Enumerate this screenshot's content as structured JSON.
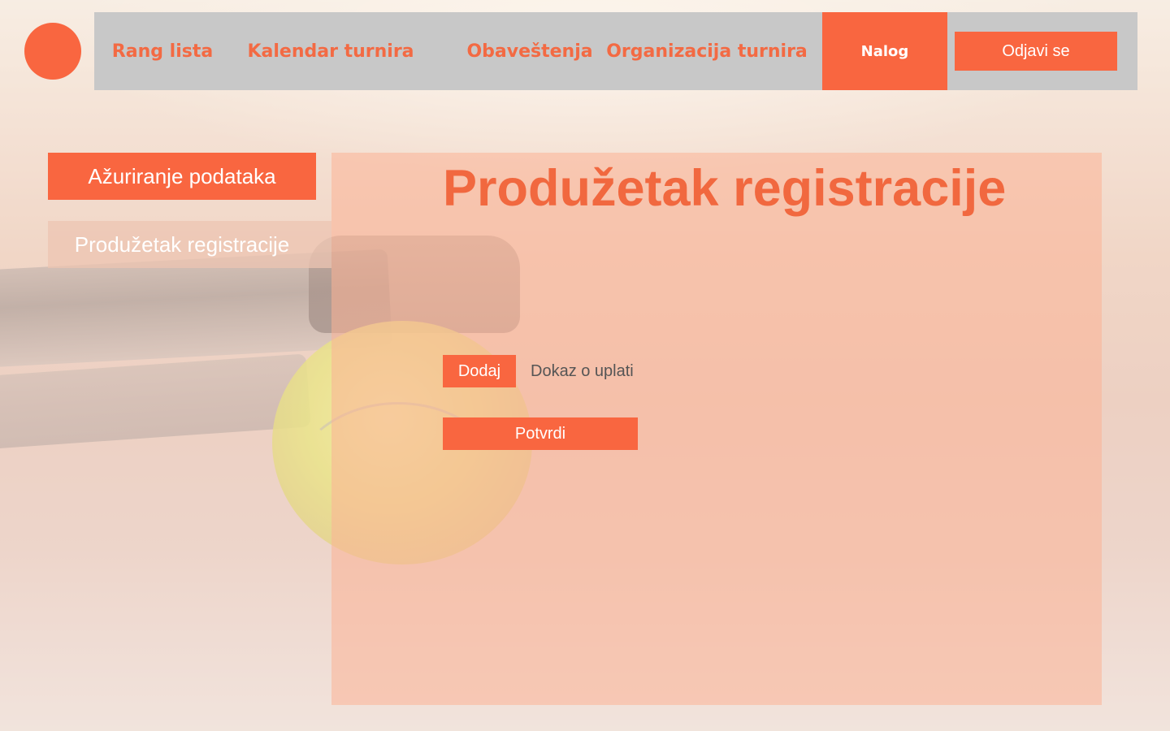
{
  "nav": {
    "items": [
      {
        "label": "Rang lista"
      },
      {
        "label": "Kalendar turnira"
      },
      {
        "label": "Obaveštenja"
      },
      {
        "label": "Organizacija turnira"
      },
      {
        "label": "Nalog",
        "active": true
      }
    ],
    "logout_label": "Odjavi se"
  },
  "sidebar": {
    "items": [
      {
        "label": "Ažuriranje podataka",
        "active": false
      },
      {
        "label": "Produžetak registracije",
        "active": true
      }
    ]
  },
  "main": {
    "title": "Produžetak registracije",
    "add_button_label": "Dodaj",
    "file_label": "Dokaz o uplati",
    "confirm_button_label": "Potvrdi"
  },
  "colors": {
    "accent": "#f96640",
    "navbar_bg": "#c8c8c8",
    "panel_bg": "#fcb296"
  }
}
